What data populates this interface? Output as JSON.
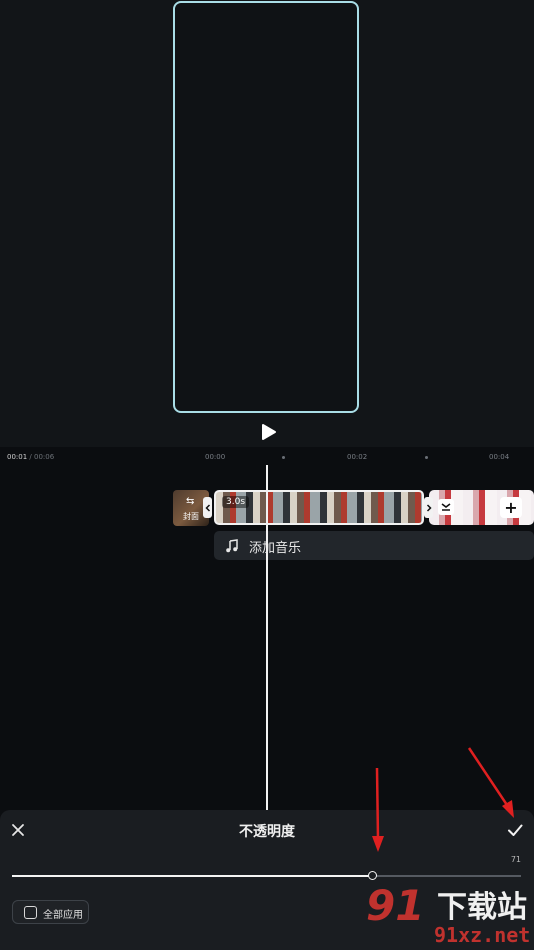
{
  "timeline": {
    "current_time": "00:01",
    "total_time": "00:06",
    "ruler_ticks": [
      "00:00",
      "00:02",
      "00:04"
    ],
    "clip_duration": "3.0s",
    "cover_label": "封面",
    "music_label": "添加音乐"
  },
  "sheet": {
    "title": "不透明度",
    "opacity_value": "71",
    "opacity_fraction": 0.71,
    "apply_all_label": "全部应用"
  },
  "watermark": {
    "brand": "91",
    "cn_text": "下载站",
    "url": "91xz.net"
  },
  "colors": {
    "frame_border": "#a9dde6",
    "annotation_red": "#e02020",
    "watermark_red": "#c0322e"
  },
  "icons": {
    "play": "play-icon",
    "close": "close-icon",
    "confirm": "check-icon",
    "music": "music-note-icon",
    "add": "plus-icon"
  }
}
